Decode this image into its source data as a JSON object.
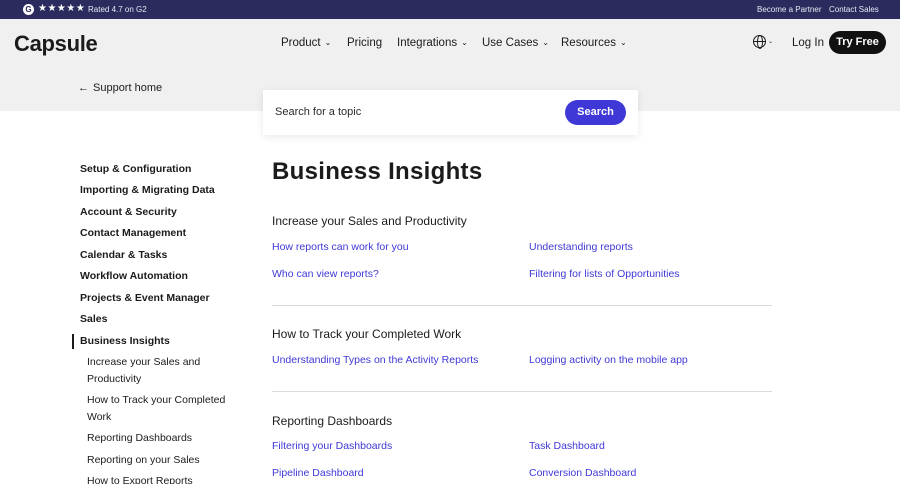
{
  "topbar": {
    "g_letter": "G",
    "stars": "★★★★★",
    "rating_text": "Rated 4.7 on G2",
    "partner_link": "Become a Partner",
    "contact_link": "Contact Sales"
  },
  "header": {
    "logo": "Capsule",
    "nav": {
      "product": "Product",
      "pricing": "Pricing",
      "integrations": "Integrations",
      "use_cases": "Use Cases",
      "resources": "Resources"
    },
    "chevron": "⌄",
    "login": "Log In",
    "try_free": "Try Free",
    "language_icon": "globe-icon"
  },
  "support": {
    "arrow": "←",
    "label": "Support home"
  },
  "search": {
    "placeholder": "Search for a topic",
    "button": "Search"
  },
  "sidebar": {
    "items": [
      "Setup & Configuration",
      "Importing & Migrating Data",
      "Account & Security",
      "Contact Management",
      "Calendar & Tasks",
      "Workflow Automation",
      "Projects & Event Manager",
      "Sales",
      "Business Insights"
    ],
    "subitems": [
      "Increase your Sales and Productivity",
      "How to Track your Completed Work",
      "Reporting Dashboards",
      "Reporting on your Sales",
      "How to Export Reports"
    ]
  },
  "main": {
    "title": "Business Insights",
    "sections": [
      {
        "title": "Increase your Sales and Productivity",
        "links": [
          "How reports can work for you",
          "Understanding reports",
          "Who can view reports?",
          "Filtering for lists of Opportunities"
        ]
      },
      {
        "title": "How to Track your Completed Work",
        "links": [
          "Understanding Types on the Activity Reports",
          "Logging activity on the mobile app"
        ]
      },
      {
        "title": "Reporting Dashboards",
        "links": [
          "Filtering your Dashboards",
          "Task Dashboard",
          "Pipeline Dashboard",
          "Conversion Dashboard"
        ]
      }
    ]
  },
  "colors": {
    "topbar": "#2c2b5e",
    "header_bg": "#f0f0f0",
    "accent": "#3f38d6",
    "text": "#1b1b1b"
  }
}
